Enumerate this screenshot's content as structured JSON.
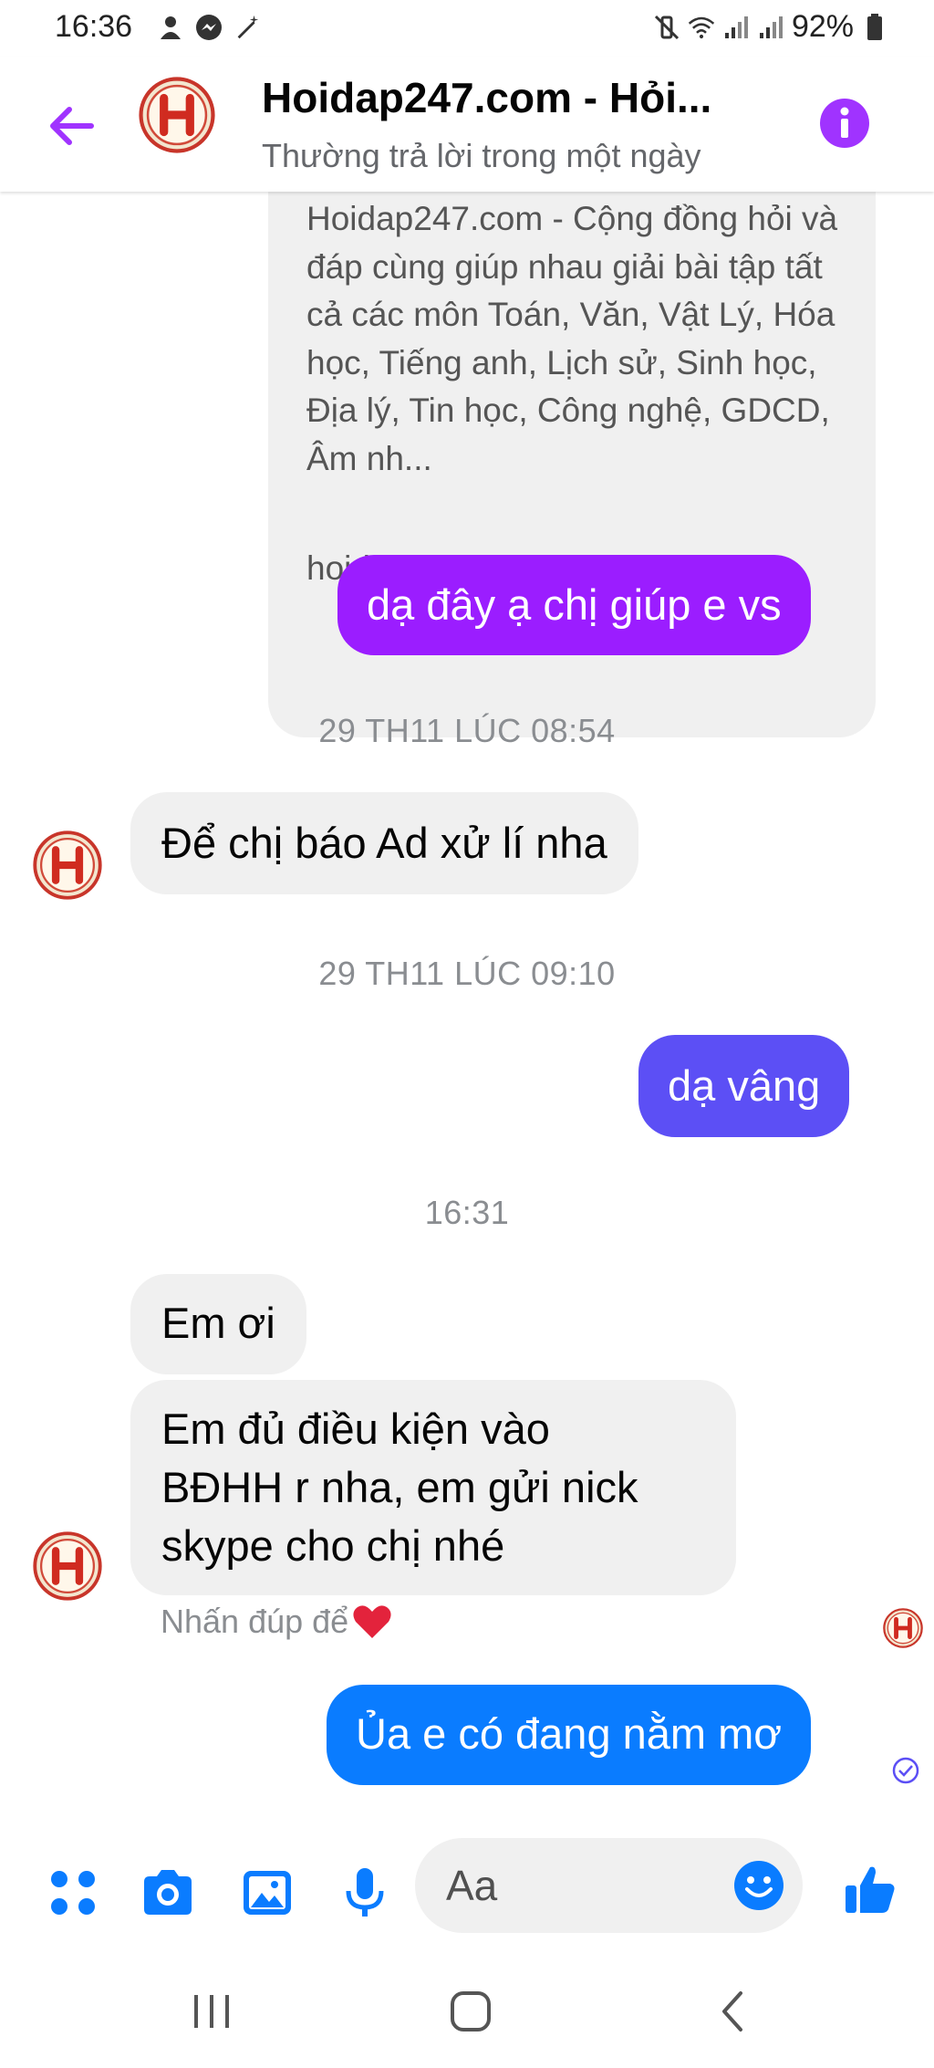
{
  "status_bar": {
    "time": "16:36",
    "battery": "92%",
    "left_icons": [
      "person-icon",
      "messenger-icon",
      "magic-wand-icon"
    ],
    "right_icons": [
      "mute-vibrate-icon",
      "wifi-icon",
      "signal-icon",
      "signal-icon",
      "battery-icon"
    ]
  },
  "header": {
    "title": "Hoidap247.com - Hỏi...",
    "subtitle": "Thường trả lời trong một ngày",
    "accent_color": "#a033ff"
  },
  "link_preview": {
    "description": "Hoidap247.com - Cộng đồng hỏi và đáp cùng giúp nhau giải bài tập tất cả các môn Toán, Văn, Vật Lý, Hóa học, Tiếng anh, Lịch sử, Sinh học, Địa lý, Tin học, Công nghệ, GDCD, Âm nh...",
    "domain": "hoidap247.com"
  },
  "messages": [
    {
      "id": "m1",
      "direction": "out",
      "color": "#9b1dff",
      "text": "dạ đây ạ chị giúp e vs"
    },
    {
      "id": "ts1",
      "type": "timestamp",
      "text": "29 TH11 LÚC 08:54"
    },
    {
      "id": "m2",
      "direction": "in",
      "text": "Để chị báo Ad xử lí nha"
    },
    {
      "id": "ts2",
      "type": "timestamp",
      "text": "29 TH11 LÚC 09:10"
    },
    {
      "id": "m3",
      "direction": "out",
      "color": "#5c4ff5",
      "text": "dạ vâng"
    },
    {
      "id": "ts3",
      "type": "timestamp",
      "text": "16:31"
    },
    {
      "id": "m4",
      "direction": "in",
      "text": "Em ơi"
    },
    {
      "id": "m5",
      "direction": "in",
      "lines": [
        "Em đủ điều kiện vào",
        "BĐHH r nha, em gửi nick",
        "skype cho chị nhé"
      ]
    },
    {
      "id": "m6",
      "direction": "out",
      "color": "#0a7cff",
      "text": "Ủa e có đang nằm mơ"
    }
  ],
  "hint": {
    "text": "Nhấn đúp để",
    "emoji": "heart-icon"
  },
  "composer": {
    "placeholder": "Aa",
    "icons": [
      "apps-grid-icon",
      "camera-icon",
      "image-icon",
      "microphone-icon",
      "emoji-icon",
      "thumbs-up-icon"
    ],
    "icon_color": "#0a7cff"
  },
  "nav_bar": {
    "buttons": [
      "recent-apps-icon",
      "home-icon",
      "back-icon"
    ]
  }
}
